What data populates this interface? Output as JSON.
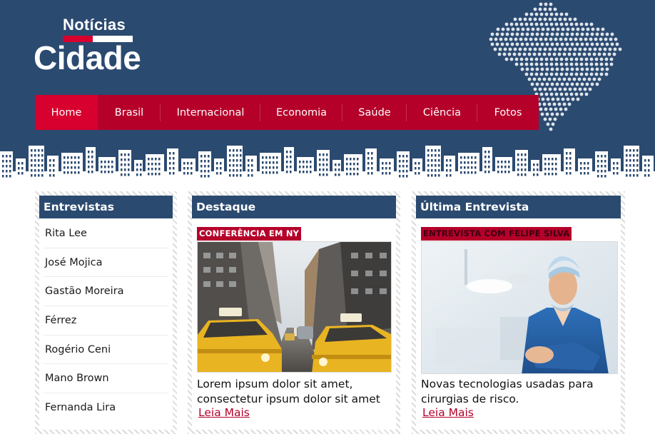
{
  "logo": {
    "top": "Notícias",
    "main": "Cidade",
    "accent": "#d8002f"
  },
  "colors": {
    "header_bg": "#2b4a70",
    "nav_bg": "#b5002a",
    "nav_active": "#d8002f",
    "link": "#b5002a"
  },
  "nav": {
    "items": [
      {
        "label": "Home",
        "active": true
      },
      {
        "label": "Brasil",
        "active": false
      },
      {
        "label": "Internacional",
        "active": false
      },
      {
        "label": "Economia",
        "active": false
      },
      {
        "label": "Saúde",
        "active": false
      },
      {
        "label": "Ciência",
        "active": false
      },
      {
        "label": "Fotos",
        "active": false
      }
    ]
  },
  "interviews": {
    "title": "Entrevistas",
    "items": [
      "Rita Lee",
      "José Mojica",
      "Gastão Moreira",
      "Férrez",
      "Rogério Ceni",
      "Mano Brown",
      "Fernanda Lira"
    ]
  },
  "featured": {
    "title": "Destaque",
    "tag": "CONFERÊNCIA EM NY",
    "image": "new-york-street-taxis",
    "caption": "Lorem ipsum dolor sit amet, consectetur ipsum dolor sit amet",
    "link": "Leia Mais"
  },
  "latest": {
    "title": "Última Entrevista",
    "tag": "ENTREVISTA COM FELIPE SILVA",
    "image": "surgeon-in-operating-room",
    "caption": "Novas tecnologias usadas para cirurgias de risco.",
    "link": "Leia Mais"
  }
}
